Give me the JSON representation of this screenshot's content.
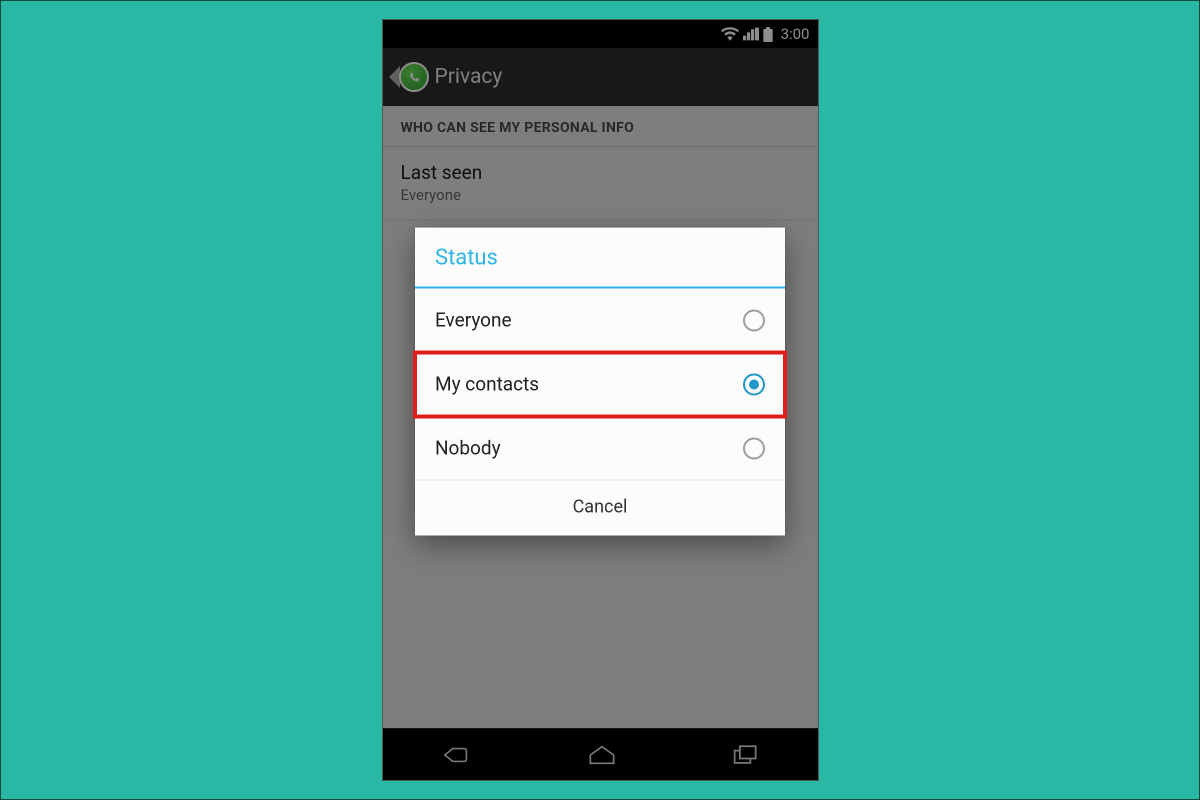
{
  "statusbar": {
    "time": "3:00"
  },
  "actionbar": {
    "title": "Privacy"
  },
  "section": {
    "header": "WHO CAN SEE MY PERSONAL INFO",
    "items": [
      {
        "label": "Last seen",
        "value": "Everyone"
      }
    ]
  },
  "dialog": {
    "title": "Status",
    "options": [
      {
        "label": "Everyone",
        "selected": false,
        "highlighted": false
      },
      {
        "label": "My contacts",
        "selected": true,
        "highlighted": true
      },
      {
        "label": "Nobody",
        "selected": false,
        "highlighted": false
      }
    ],
    "cancel": "Cancel"
  }
}
